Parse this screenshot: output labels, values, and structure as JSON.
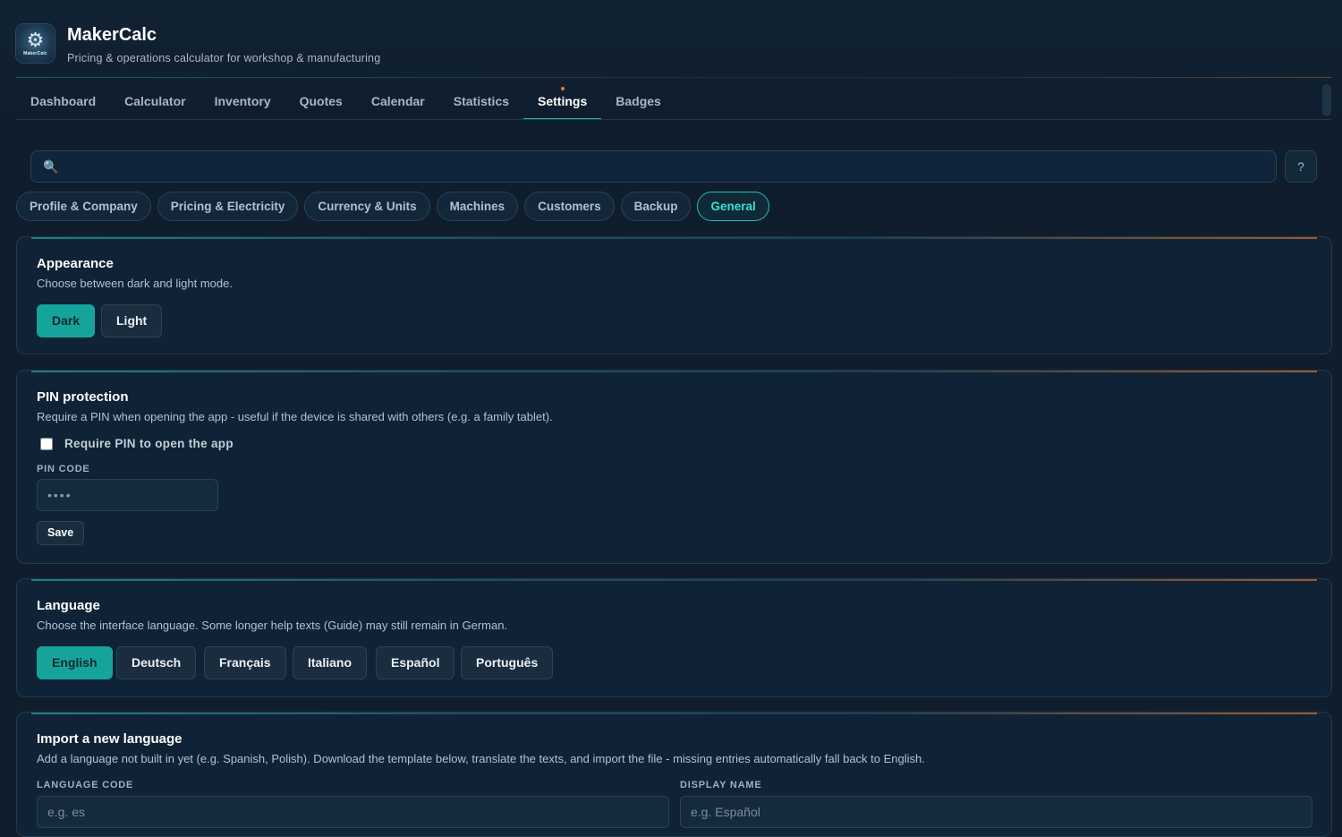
{
  "app": {
    "title": "MakerCalc",
    "subtitle": "Pricing & operations calculator for workshop & manufacturing",
    "logo_text": "MakerCalc"
  },
  "nav": {
    "tabs": [
      {
        "label": "Dashboard"
      },
      {
        "label": "Calculator"
      },
      {
        "label": "Inventory"
      },
      {
        "label": "Quotes"
      },
      {
        "label": "Calendar"
      },
      {
        "label": "Statistics"
      },
      {
        "label": "Settings",
        "active": true
      },
      {
        "label": "Badges"
      }
    ]
  },
  "search": {
    "value": "",
    "placeholder": "",
    "help_label": "?"
  },
  "settings_tabs": [
    {
      "label": "Profile & Company"
    },
    {
      "label": "Pricing & Electricity"
    },
    {
      "label": "Currency & Units"
    },
    {
      "label": "Machines"
    },
    {
      "label": "Customers"
    },
    {
      "label": "Backup"
    },
    {
      "label": "General",
      "active": true
    }
  ],
  "appearance": {
    "title": "Appearance",
    "description": "Choose between dark and light mode.",
    "options": [
      {
        "label": "Dark",
        "selected": true
      },
      {
        "label": "Light"
      }
    ]
  },
  "pin": {
    "title": "PIN protection",
    "description": "Require a PIN when opening the app - useful if the device is shared with others (e.g. a family tablet).",
    "checkbox_label": "Require PIN to open the app",
    "checked": false,
    "field_label": "PIN CODE",
    "field_placeholder": "••••",
    "save_label": "Save"
  },
  "language": {
    "title": "Language",
    "description": "Choose the interface language. Some longer help texts (Guide) may still remain in German.",
    "options": [
      {
        "label": "English",
        "selected": true
      },
      {
        "label": "Deutsch"
      },
      {
        "label": "Français"
      },
      {
        "label": "Italiano"
      },
      {
        "label": "Español"
      },
      {
        "label": "Português"
      }
    ]
  },
  "import_language": {
    "title": "Import a new language",
    "description": "Add a language not built in yet (e.g. Spanish, Polish). Download the template below, translate the texts, and import the file - missing entries automatically fall back to English.",
    "code_label": "LANGUAGE CODE",
    "code_placeholder": "e.g. es",
    "name_label": "DISPLAY NAME",
    "name_placeholder": "e.g. Español"
  },
  "colors": {
    "background": "#0f1d2c",
    "card": "#102235",
    "accent_teal": "#16a39b",
    "accent_orange": "#f07a2a"
  }
}
